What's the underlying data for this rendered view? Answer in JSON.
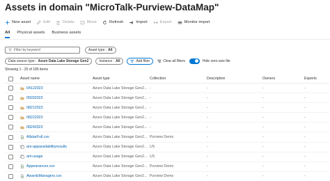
{
  "header": {
    "title": "Assets in domain \"MicroTalk-Purview-DataMap\""
  },
  "toolbar": {
    "new_asset": "New asset",
    "edit": "Edit",
    "delete": "Delete",
    "move": "Move",
    "refresh": "Refresh",
    "import": "Import",
    "export": "Export",
    "monitor_import": "Monitor import"
  },
  "tabs": {
    "all": "All",
    "physical": "Physical assets",
    "business": "Business assets"
  },
  "filters": {
    "keyword_placeholder": "Filter by keyword",
    "asset_type_label": "Asset type :",
    "asset_type_value": "All",
    "data_source_label": "Data source type :",
    "data_source_value": "Azure Data Lake Storage Gen2",
    "instance_label": "Instance :",
    "instance_value": "All",
    "add_filter": "Add filter",
    "clear_all": "Clear all filters",
    "hide_zero": "Hide zero-size file"
  },
  "showing": "Showing 1 - 25 of 185 items",
  "table": {
    "columns": {
      "name": "Asset name",
      "type": "Asset type",
      "collection": "Collection",
      "description": "Description",
      "owners": "Owners",
      "experts": "Experts"
    },
    "rows": [
      {
        "icon": "folder-icon",
        "name": "04122023",
        "type": "Azure Data Lake Storage Gen2...",
        "collection": "-",
        "description": "-",
        "owners": "-",
        "experts": "-"
      },
      {
        "icon": "folder-icon",
        "name": "05032023",
        "type": "Azure Data Lake Storage Gen2...",
        "collection": "-",
        "description": "-",
        "owners": "-",
        "experts": "-"
      },
      {
        "icon": "folder-icon",
        "name": "08212023",
        "type": "Azure Data Lake Storage Gen2...",
        "collection": "-",
        "description": "-",
        "owners": "-",
        "experts": "-"
      },
      {
        "icon": "folder-icon",
        "name": "08222023",
        "type": "Azure Data Lake Storage Gen2...",
        "collection": "-",
        "description": "-",
        "owners": "-",
        "experts": "-"
      },
      {
        "icon": "folder-icon",
        "name": "08242023",
        "type": "Azure Data Lake Storage Gen2...",
        "collection": "-",
        "description": "-",
        "owners": "-",
        "experts": "-"
      },
      {
        "icon": "file-icon",
        "name": "AllstarFull.csv",
        "type": "Azure Data Lake Storage Gen2...",
        "collection": "Purview Demo",
        "description": "-",
        "owners": "-",
        "experts": "-"
      },
      {
        "icon": "resource-set-icon",
        "name": "am-appavailabilityresults",
        "type": "Azure Data Lake Storage Gen2...",
        "collection": "US",
        "description": "-",
        "owners": "-",
        "experts": "-"
      },
      {
        "icon": "resource-set-icon",
        "name": "am-usage",
        "type": "Azure Data Lake Storage Gen2...",
        "collection": "US",
        "description": "-",
        "owners": "-",
        "experts": "-"
      },
      {
        "icon": "file-icon",
        "name": "Appearances.csv",
        "type": "Azure Data Lake Storage Gen2...",
        "collection": "Purview Demo",
        "description": "-",
        "owners": "-",
        "experts": "-"
      },
      {
        "icon": "file-icon",
        "name": "AwardsManagers.csv",
        "type": "Azure Data Lake Storage Gen2...",
        "collection": "Purview Demo",
        "description": "-",
        "owners": "-",
        "experts": "-"
      }
    ]
  }
}
